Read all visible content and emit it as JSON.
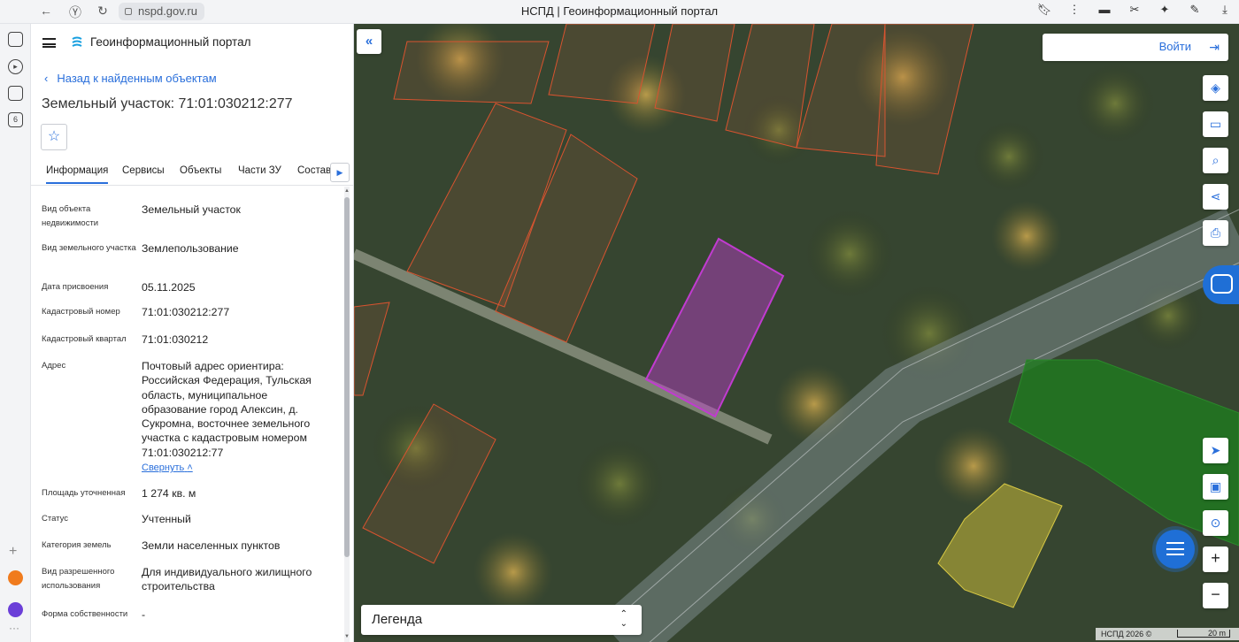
{
  "browser": {
    "url": "nspd.gov.ru",
    "tab_title": "НСПД | Геоинформационный портал"
  },
  "app": {
    "portal_title": "Геоинформационный портал",
    "back_link": "Назад к найденным объектам",
    "object_title": "Земельный участок: 71:01:030212:277",
    "tabs": [
      "Информация",
      "Сервисы",
      "Объекты",
      "Части ЗУ",
      "Состав"
    ],
    "active_tab": "Информация"
  },
  "properties": [
    {
      "label": "Вид объекта недвижимости",
      "value": "Земельный участок"
    },
    {
      "label": "Вид земельного участка",
      "value": "Землепользование"
    },
    {
      "label": "Дата присвоения",
      "value": "05.11.2025"
    },
    {
      "label": "Кадастровый номер",
      "value": "71:01:030212:277"
    },
    {
      "label": "Кадастровый квартал",
      "value": "71:01:030212"
    },
    {
      "label": "Адрес",
      "value": "Почтовый адрес ориентира: Российская Федерация, Тульская область, муниципальное образование город Алексин, д. Сукромна, восточнее земельного участка с кадастровым номером 71:01:030212:77"
    },
    {
      "label": "Площадь уточненная",
      "value": "1 274 кв. м"
    },
    {
      "label": "Статус",
      "value": "Учтенный"
    },
    {
      "label": "Категория земель",
      "value": "Земли населенных пунктов"
    },
    {
      "label": "Вид разрешенного использования",
      "value": "Для индивидуального жилищного строительства"
    },
    {
      "label": "Форма собственности",
      "value": "-"
    }
  ],
  "collapse_label": "Свернуть",
  "map": {
    "login_label": "Войти",
    "legend_label": "Легенда",
    "attribution": "НСПД 2026 ©",
    "scale_label": "20 m"
  },
  "colors": {
    "accent": "#2a6fdb",
    "selected_parcel": "#c13bd0",
    "parcel_border": "#d9532f",
    "green_zone": "#1f7a1f",
    "yellow_zone": "#c9b93a"
  },
  "icons": {
    "collapse_panel": "double-chevron-left-icon",
    "login": "login-icon",
    "layers": "layers-icon",
    "ruler": "ruler-icon",
    "search_area": "search-area-icon",
    "share": "share-icon",
    "print": "print-icon",
    "locate": "locate-icon",
    "zoom_in": "plus-icon",
    "zoom_out": "minus-icon"
  }
}
